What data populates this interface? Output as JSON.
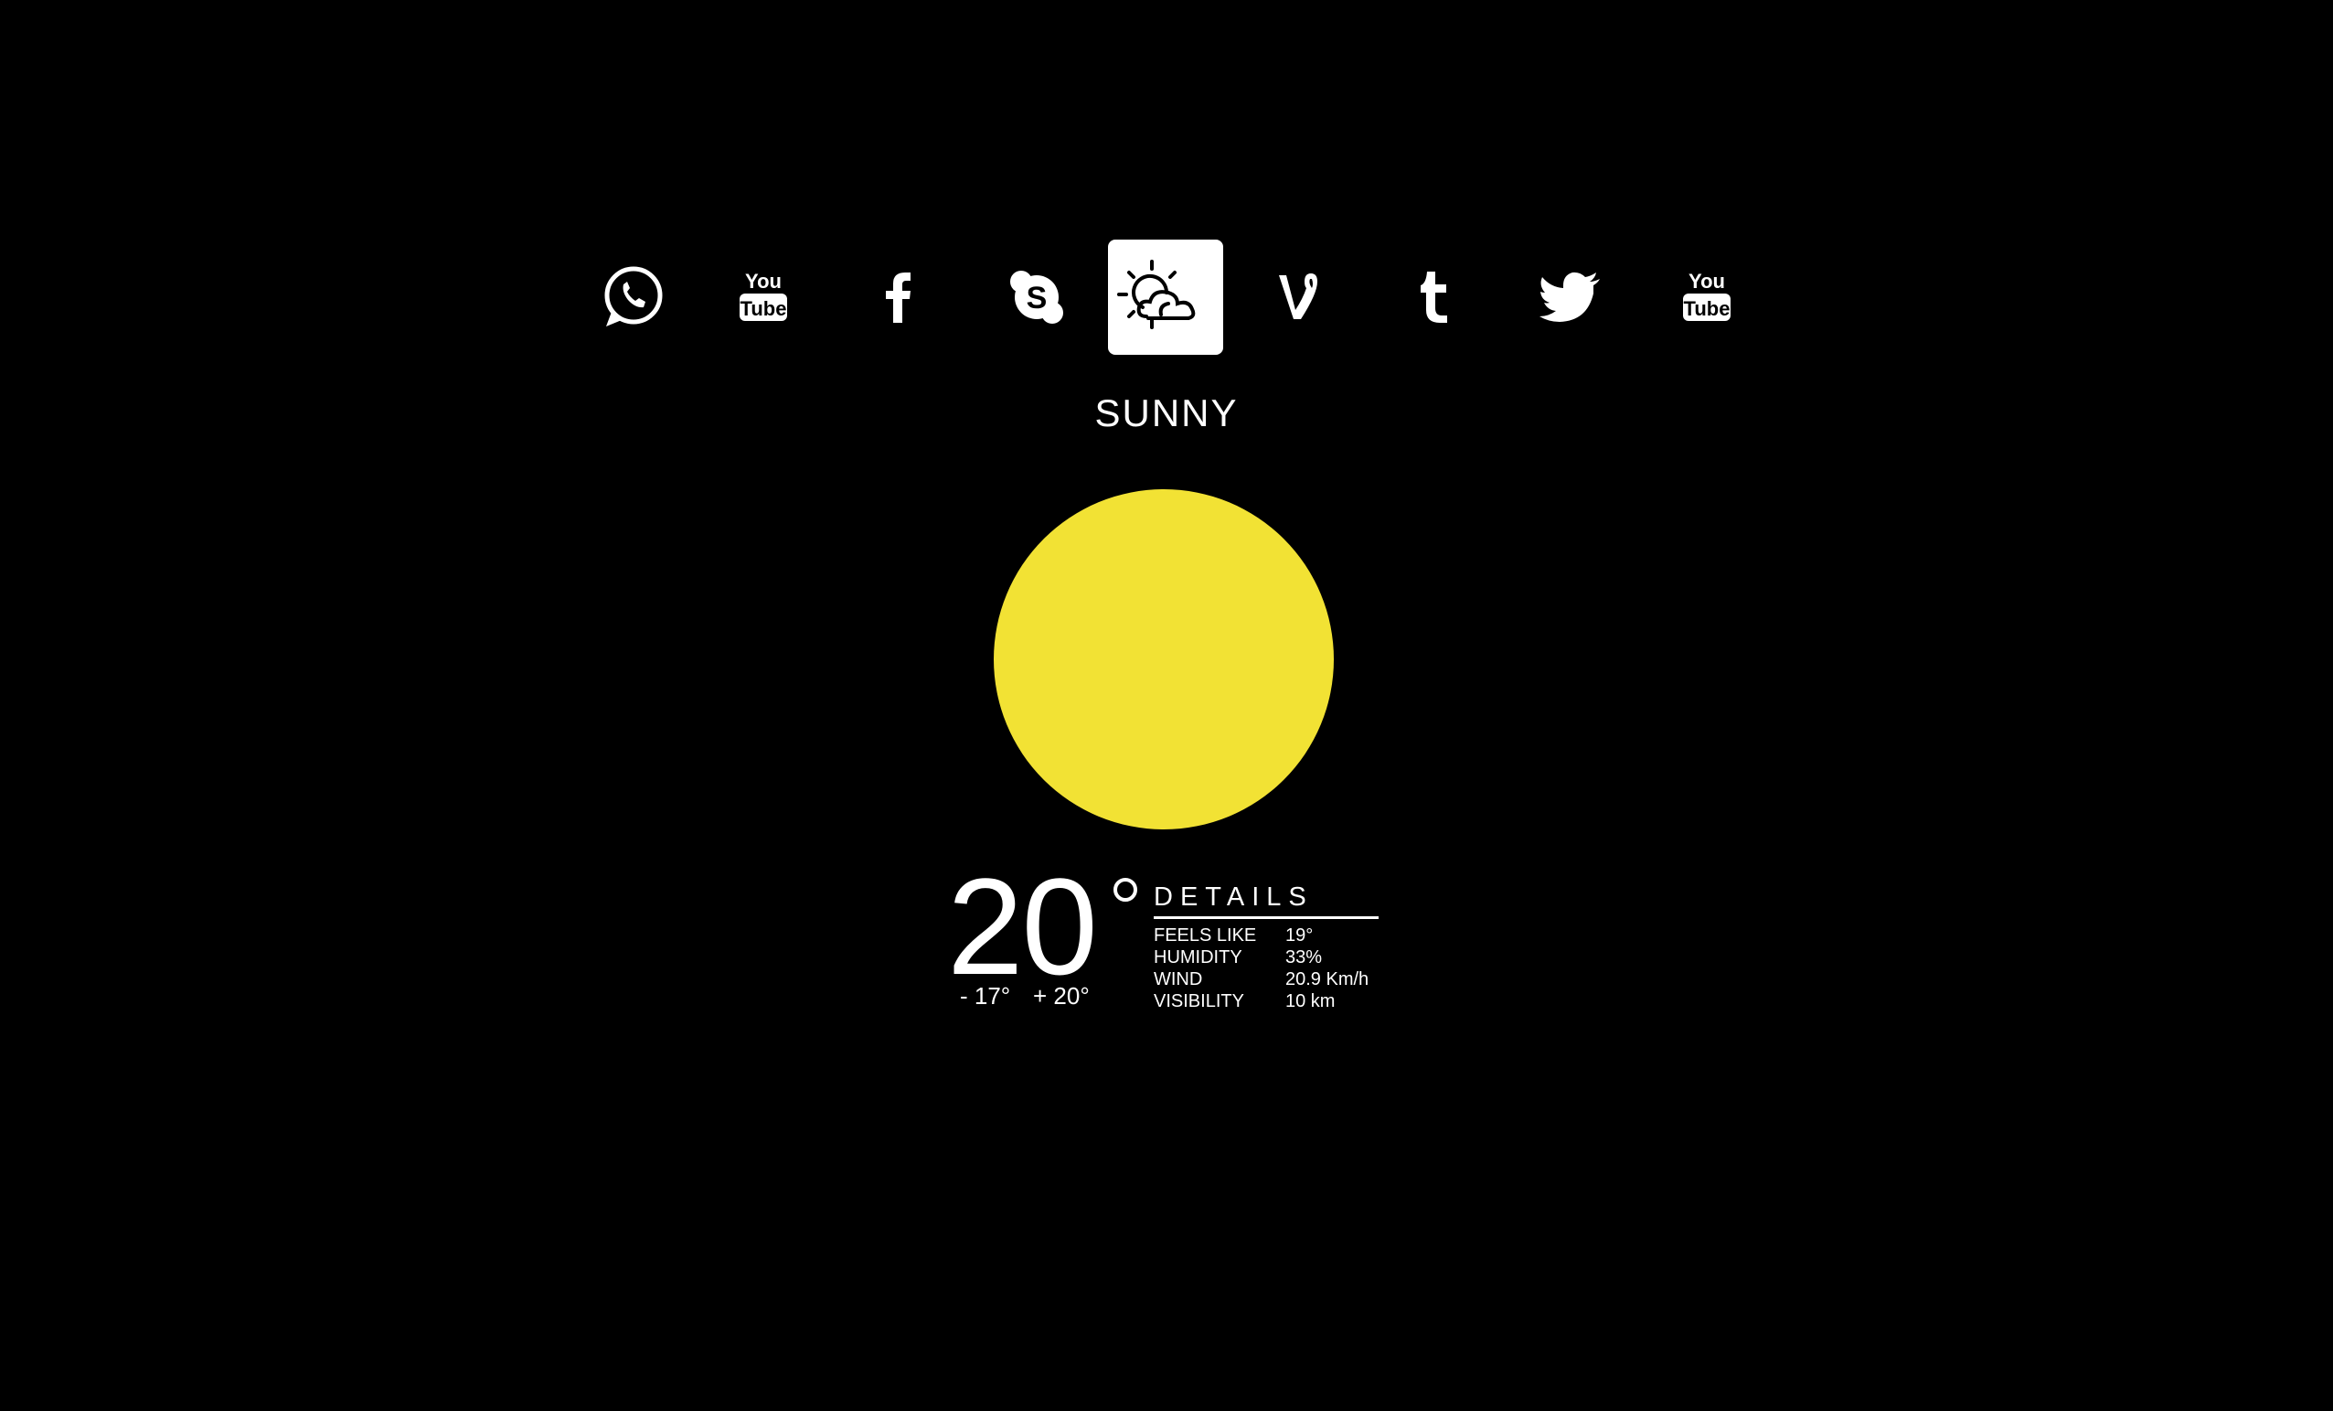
{
  "icons": [
    {
      "name": "whatsapp-icon",
      "active": false
    },
    {
      "name": "youtube-icon",
      "active": false
    },
    {
      "name": "facebook-icon",
      "active": false
    },
    {
      "name": "skype-icon",
      "active": false
    },
    {
      "name": "weather-partly-sunny-icon",
      "active": true
    },
    {
      "name": "vine-icon",
      "active": false
    },
    {
      "name": "tumblr-icon",
      "active": false
    },
    {
      "name": "twitter-icon",
      "active": false
    },
    {
      "name": "youtube-icon",
      "active": false
    }
  ],
  "weather": {
    "condition": "SUNNY",
    "temperature": "20",
    "min": "- 17°",
    "max": "+ 20°",
    "sun_color": "#f2e234"
  },
  "details": {
    "title": "DETAILS",
    "rows": [
      {
        "label": "FEELS LIKE",
        "value": "19°"
      },
      {
        "label": "HUMIDITY",
        "value": "33%"
      },
      {
        "label": "WIND",
        "value": "20.9 Km/h"
      },
      {
        "label": "VISIBILITY",
        "value": "10 km"
      }
    ]
  }
}
